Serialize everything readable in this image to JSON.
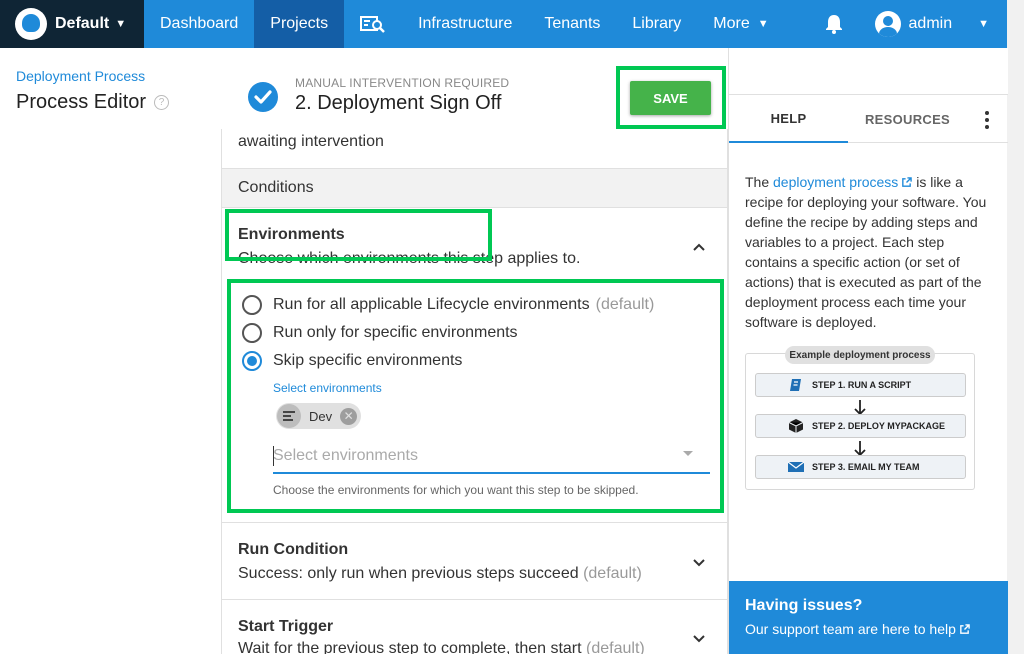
{
  "nav": {
    "space": "Default",
    "items": [
      "Dashboard",
      "Projects",
      "Infrastructure",
      "Tenants",
      "Library",
      "More"
    ],
    "user": "admin"
  },
  "header": {
    "breadcrumb": "Deployment Process",
    "title": "Process Editor"
  },
  "step": {
    "kicker": "MANUAL INTERVENTION REQUIRED",
    "title": "2.  Deployment Sign Off",
    "save_label": "SAVE"
  },
  "panel": {
    "partial_text": "awaiting intervention",
    "conditions_label": "Conditions",
    "environments": {
      "title": "Environments",
      "subtitle": "Choose which environments this step applies to.",
      "options": [
        {
          "label": "Run for all applicable Lifecycle environments",
          "suffix": "(default)",
          "checked": false
        },
        {
          "label": "Run only for specific environments",
          "suffix": "",
          "checked": false
        },
        {
          "label": "Skip specific environments",
          "suffix": "",
          "checked": true
        }
      ],
      "select_label": "Select environments",
      "chips": [
        "Dev"
      ],
      "input_placeholder": "Select environments",
      "hint": "Choose the environments for which you want this step to be skipped."
    },
    "run_condition": {
      "title": "Run Condition",
      "subtitle": "Success: only run when previous steps succeed",
      "suffix": "(default)"
    },
    "start_trigger": {
      "title": "Start Trigger",
      "subtitle": "Wait for the previous step to complete, then start",
      "suffix": "(default)"
    }
  },
  "help": {
    "tabs": [
      "HELP",
      "RESOURCES"
    ],
    "text_pre": "The ",
    "link": "deployment process",
    "text_post": " is like a recipe for deploying your software. You define the recipe by adding steps and variables to a project. Each step contains a specific action (or set of actions) that is executed as part of the deployment process each time your software is deployed.",
    "diagram": {
      "title": "Example deployment process",
      "steps": [
        "STEP 1. RUN A SCRIPT",
        "STEP 2. DEPLOY MYPACKAGE",
        "STEP 3. EMAIL MY TEAM"
      ]
    },
    "issues_title": "Having issues?",
    "issues_text": "Our support team are here to help"
  },
  "colors": {
    "accent": "#1f8ad9",
    "nav_active": "#145ea6",
    "brand_bg": "#0f2535",
    "save": "#45b34a",
    "highlight": "#00c853"
  }
}
